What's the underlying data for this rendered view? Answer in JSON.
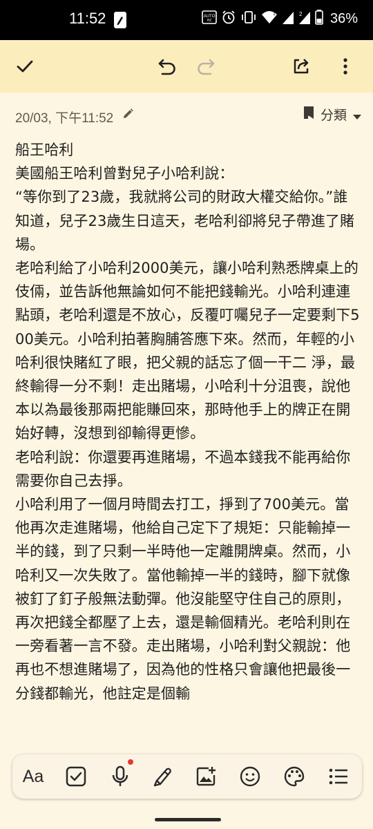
{
  "status_bar": {
    "time": "11:52",
    "battery": "36%",
    "icons": [
      "keep-notes-icon",
      "auto-brightness-icon",
      "alarm-icon",
      "vibrate-icon",
      "wifi-icon",
      "signal-icon",
      "signal-icon",
      "battery-icon"
    ]
  },
  "toolbar": {
    "icons": [
      "check-icon",
      "undo-icon",
      "redo-icon",
      "share-icon",
      "more-vert-icon"
    ]
  },
  "note_meta": {
    "date": "20/03, 下午11:52",
    "label_button": "分類"
  },
  "note": {
    "lines": [
      "船王哈利",
      "美國船王哈利曾對兒子小哈利說：",
      "“等你到了23歲，我就將公司的財政大權交給你。”誰知道，兒子23歲生日這天，老哈利卻將兒子帶進了賭場。",
      "老哈利給了小哈利2000美元，讓小哈利熟悉牌桌上的伎倆，並告訴他無論如何不能把錢輸光。小哈利連連點頭，老哈利還是不放心，反覆叮囑兒子一定要剩下500美元。小哈利拍著胸脯答應下來。然而，年輕的小哈利很快賭紅了眼，把父親的話忘了個一干二 淨，最終輸得一分不剩！走出賭場，小哈利十分沮喪，說他本以為最後那兩把能賺回來，那時他手上的牌正在開始好轉，沒想到卻輸得更慘。",
      "老哈利說：你還要再進賭場，不過本錢我不能再給你需要你自己去掙。",
      "小哈利用了一個月時間去打工，掙到了700美元。當他再次走進賭場，他給自己定下了規矩：只能輸掉一半的錢，到了只剩一半時他一定離開牌桌。然而，小哈利又一次失敗了。當他輸掉一半的錢時，腳下就像被釘了釘子般無法動彈。他沒能堅守住自己的原則，再次把錢全都壓了上去，還是輸個精光。老哈利則在一旁看著一言不發。走出賭場，小哈利對父親說：他再也不想進賭場了，因為他的性格只會讓他把最後一分錢都輸光，他註定是個輸"
    ]
  },
  "bottom_bar": {
    "text_format": "Aa",
    "icons": [
      "text-format-icon",
      "checkbox-icon",
      "microphone-icon",
      "brush-icon",
      "add-image-icon",
      "emoji-icon",
      "palette-icon",
      "list-icon"
    ],
    "accent_color": "#e53935"
  },
  "colors": {
    "background": "#fdf6e2",
    "toolbar": "#fcedbd",
    "status_bar": "#000000"
  }
}
